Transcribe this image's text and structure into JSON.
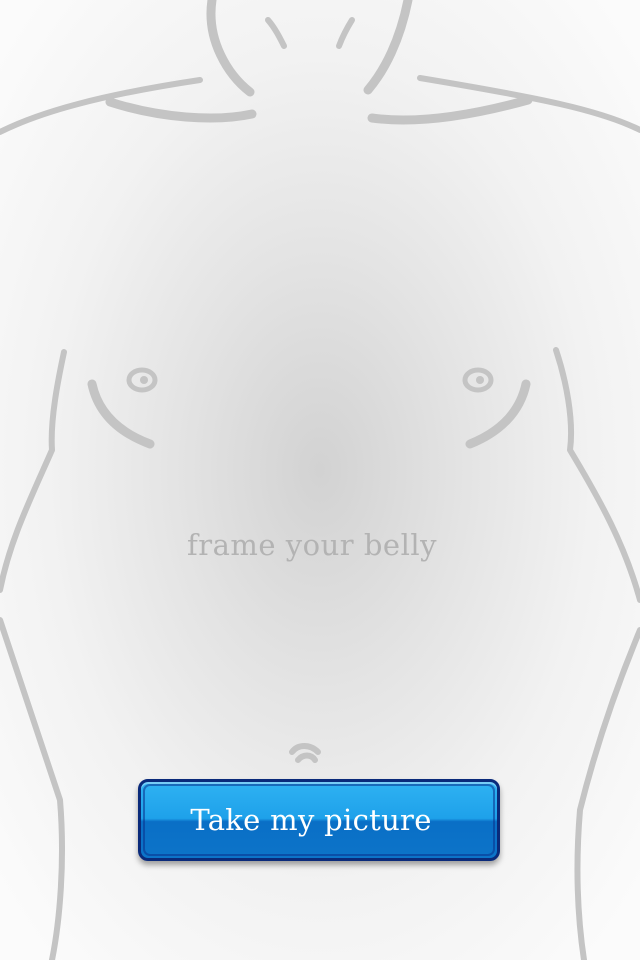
{
  "guide": {
    "text": "frame your belly"
  },
  "action": {
    "take_picture_label": "Take my picture"
  },
  "colors": {
    "outline": "#c4c4c4",
    "guide_text": "#b3b3b3",
    "button_top": "#2fb2f2",
    "button_bottom": "#0a6fc6",
    "button_border": "#0a2a7a",
    "button_text": "#ffffff"
  },
  "illustration": {
    "subject": "male-torso-outline"
  }
}
